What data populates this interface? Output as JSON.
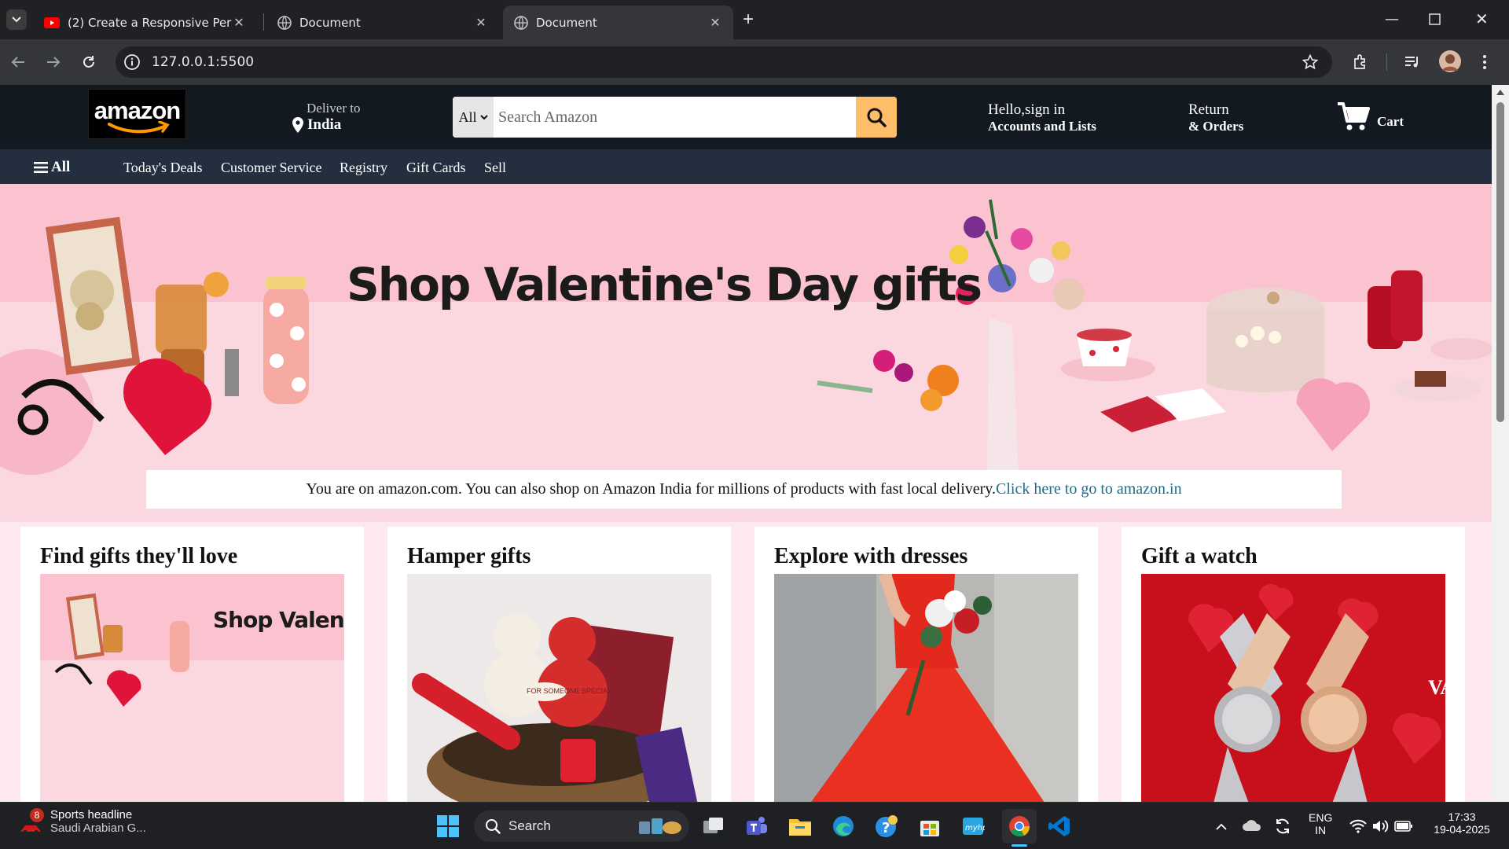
{
  "browser": {
    "tabs": [
      {
        "label": "(2) Create a Responsive Persona",
        "icon": "youtube-icon"
      },
      {
        "label": "Document",
        "icon": "globe-icon"
      },
      {
        "label": "Document",
        "icon": "globe-icon"
      }
    ],
    "url": "127.0.0.1:5500"
  },
  "header": {
    "logo_text": "amazon",
    "deliver_label": "Deliver to",
    "deliver_location": "India",
    "search_category": "All",
    "search_placeholder": "Search Amazon",
    "account_line1": "Hello,sign in",
    "account_line2": "Accounts and Lists",
    "orders_line1": "Return",
    "orders_line2": "& Orders",
    "cart_label": "Cart"
  },
  "subnav": {
    "all_label": "All",
    "items": [
      "Today's Deals",
      "Customer Service",
      "Registry",
      "Gift Cards",
      "Sell"
    ]
  },
  "hero": {
    "title": "Shop Valentine's Day gifts"
  },
  "notice": {
    "text": "You are on amazon.com. You can also shop on Amazon India for millions of products with fast local delivery.",
    "link": "Click here to go to amazon.in"
  },
  "cards": [
    {
      "title": "Find gifts they'll love",
      "thumb_text": "Shop Valenti"
    },
    {
      "title": "Hamper gifts",
      "thumb_text": "FOR SOMEONE SPECIAL"
    },
    {
      "title": "Explore with dresses"
    },
    {
      "title": "Gift a watch",
      "thumb_text": "VA"
    }
  ],
  "taskbar": {
    "news_badge": "8",
    "news_title": "Sports headline",
    "news_sub": "Saudi Arabian G...",
    "search_label": "Search",
    "lang": "ENG",
    "region": "IN",
    "time": "17:33",
    "date": "19-04-2025"
  },
  "colors": {
    "amazon_dark": "#131921",
    "amazon_subnav": "#232f3e",
    "search_button": "#febd69",
    "hero_pink": "#fbc3cf",
    "link_teal": "#1d6c8d"
  }
}
